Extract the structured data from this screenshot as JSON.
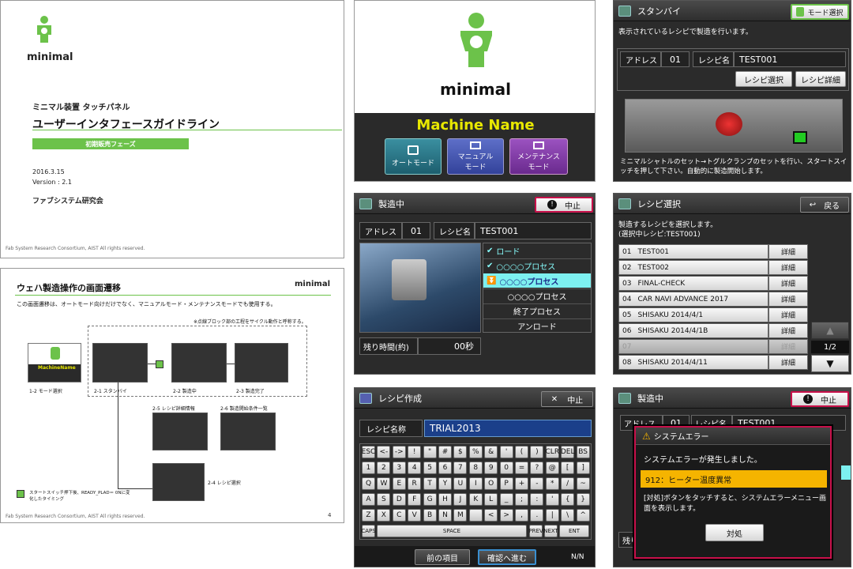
{
  "slide1": {
    "brand": "minimal",
    "line1": "ミニマル装置 タッチパネル",
    "title": "ユーザーインタフェースガイドライン",
    "badge": "初期販売フェーズ",
    "date": "2016.3.15",
    "version": "Version : 2.1",
    "org": "ファブシステム研究会",
    "footer": "Fab System Research Consortium, AIST All rights reserved."
  },
  "slide2": {
    "title": "ウェハ製造操作の画面遷移",
    "brand": "minimal",
    "desc": "この画面遷移は、オートモード向けだけでなく、マニュアルモード・メンテナンスモードでも使用する。",
    "note": "※点線ブロック部の工程をサイクル動作と呼称する。",
    "caps": [
      "1-2 モード選択",
      "2-1 スタンバイ",
      "2-2 製造中",
      "2-3 製造完了",
      "2-5 レシピ詳細情報",
      "2-6 製造開始条件一覧",
      "2-4 レシピ選択"
    ],
    "mini_mn": "MachineName",
    "legend": "スタートスイッチ押下後、READY_PLAD＝ 0Nに変化したタイミング",
    "footer": "Fab System Research Consortium, AIST All rights reserved.",
    "page": "4"
  },
  "splash": {
    "brand": "minimal",
    "machine": "Machine Name",
    "modes": [
      "オートモード",
      "マニュアル\nモード",
      "メンテナンス\nモード"
    ]
  },
  "standby": {
    "title": "スタンバイ",
    "mode_btn": "モード選択",
    "msg": "表示されているレシピで製造を行います。",
    "addr_label": "アドレス",
    "addr": "01",
    "recipe_label": "レシピ名",
    "recipe": "TEST001",
    "sel_btn": "レシピ選択",
    "detail_btn": "レシピ詳細",
    "hint": "ミニマルシャトルのセット→トグルクランプのセットを行い、スタートスイッチを押して下さい。自動的に製造開始します。"
  },
  "mfg": {
    "title": "製造中",
    "stop": "中止",
    "addr_label": "アドレス",
    "addr": "01",
    "recipe_label": "レシピ名",
    "recipe": "TEST001",
    "steps": [
      "ロード",
      "○○○○プロセス",
      "○○○○プロセス",
      "○○○○プロセス",
      "終了プロセス",
      "アンロード"
    ],
    "remain_label": "残り時間(約)",
    "remain": "00秒"
  },
  "recipe_sel": {
    "title": "レシピ選択",
    "back": "戻る",
    "msg1": "製造するレシピを選択します。",
    "msg2": "(選択中レシピ:TEST001)",
    "rows": [
      {
        "no": "01",
        "name": "TEST001",
        "btn": "詳細"
      },
      {
        "no": "02",
        "name": "TEST002",
        "btn": "詳細"
      },
      {
        "no": "03",
        "name": "FINAL-CHECK",
        "btn": "詳細"
      },
      {
        "no": "04",
        "name": "CAR NAVI ADVANCE 2017",
        "btn": "詳細"
      },
      {
        "no": "05",
        "name": "SHISAKU 2014/4/1",
        "btn": "詳細"
      },
      {
        "no": "06",
        "name": "SHISAKU 2014/4/1B",
        "btn": "詳細"
      },
      {
        "no": "07",
        "name": "",
        "btn": "詳細"
      },
      {
        "no": "08",
        "name": "SHISAKU 2014/4/11",
        "btn": "詳細"
      }
    ],
    "page": "1/2"
  },
  "create": {
    "title": "レシピ作成",
    "stop": "中止",
    "name_label": "レシピ名称",
    "name_value": "TRIAL2013",
    "row1": [
      "ESC",
      "<-",
      "->",
      "!",
      "\"",
      "#",
      "$",
      "%",
      "&",
      "'",
      "(",
      ")",
      "CLR",
      "DEL",
      "BS"
    ],
    "row2": [
      "1",
      "2",
      "3",
      "4",
      "5",
      "6",
      "7",
      "8",
      "9",
      "0",
      "=",
      "?",
      "@",
      "[",
      "]"
    ],
    "row3": [
      "Q",
      "W",
      "E",
      "R",
      "T",
      "Y",
      "U",
      "I",
      "O",
      "P",
      "+",
      "-",
      "*",
      "/",
      "~"
    ],
    "row4": [
      "A",
      "S",
      "D",
      "F",
      "G",
      "H",
      "J",
      "K",
      "L",
      "_",
      ";",
      ":",
      "'",
      "{",
      "}"
    ],
    "row5": [
      "Z",
      "X",
      "C",
      "V",
      "B",
      "N",
      "M",
      "",
      "<",
      ">",
      ",",
      ".",
      "|",
      "\\",
      "^"
    ],
    "caps": "CAPS",
    "space": "SPACE",
    "prev": "PREV",
    "next": "NEXT",
    "ent": "ENT",
    "prev_item": "前の項目",
    "confirm": "確認へ進む",
    "nn": "N/N"
  },
  "error": {
    "title": "製造中",
    "stop": "中止",
    "bg_addr": "アドレス",
    "bg_addr_val": "01",
    "bg_recipe_label": "レシピ名",
    "bg_recipe": "TEST001",
    "bg_remain": "残り",
    "dlg_title": "システムエラー",
    "dlg_msg": "システムエラーが発生しました。",
    "code": "912：ヒーター温度異常",
    "hint": "[対処]ボタンをタッチすると、システムエラーメニュー画面を表示します。",
    "action": "対処"
  },
  "colors": {
    "green": "#6cc24a",
    "purple": "#7b3fa0",
    "cyan": "#7df0f0",
    "orange": "#f5b400",
    "red": "#c8104a"
  }
}
